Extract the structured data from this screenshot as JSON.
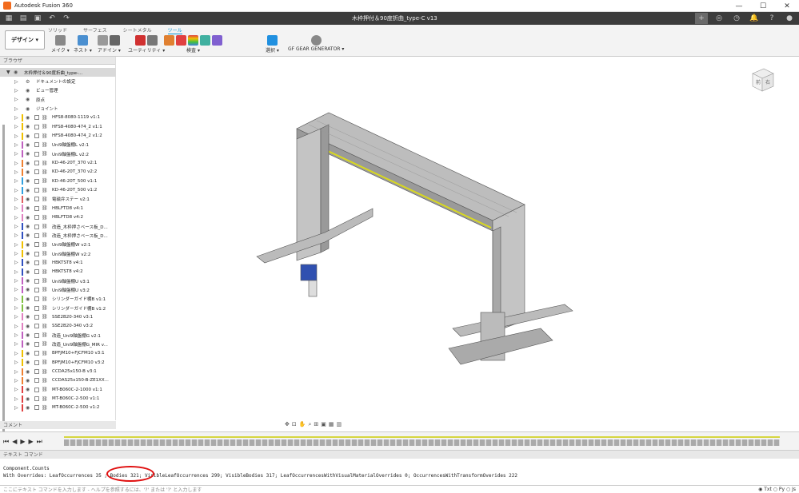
{
  "app": {
    "title": "Autodesk Fusion 360",
    "document_title": "木枠押付＆90度折曲_type-C v13"
  },
  "ribbon": {
    "tabs": [
      "ソリッド",
      "サーフェス",
      "シートメタル",
      "ツール"
    ],
    "active_tab": "ツール",
    "design_button": "デザイン ▾",
    "groups": [
      "メイク ▾",
      "ネスト ▾",
      "アドイン ▾",
      "ユーティリティ ▾",
      "検査 ▾",
      "選択 ▾",
      "GF GEAR GENERATOR ▾"
    ]
  },
  "browser": {
    "header": "ブラウザ",
    "root": "木枠押付＆90度折曲_type-...",
    "items": [
      "ドキュメントの設定",
      "ビュー管理",
      "原点",
      "ジョイント",
      "HFS8-8080-1119 v1:1",
      "HFS8-4080-474_2 v1:1",
      "HFS8-4080-474_2 v1:2",
      "Uni9軸盤棚L v2:1",
      "Uni9軸盤棚L v2:2",
      "KD-46-20T_370 v2:1",
      "KD-46-20T_370 v2:2",
      "KD-46-20T_500 v1:1",
      "KD-46-20T_500 v1:2",
      "電磁弁ステー v2:1",
      "HBLFTD8 v4:1",
      "HBLFTD8 v4:2",
      "改造_木枠押さベース板_D...",
      "改造_木枠押さベース板_D...",
      "Uni9軸盤棚W v2:1",
      "Uni9軸盤棚W v2:2",
      "HBKTST8 v4:1",
      "HBKTST8 v4:2",
      "Uni9軸盤棚U v3:1",
      "Uni9軸盤棚U v3:2",
      "シリンダーガイド棚B v1:1",
      "シリンダーガイド棚B v1:2",
      "SSE2B20-340 v3:1",
      "SSE2B20-340 v3:2",
      "改造_Uni9軸盤棚G v2:1",
      "改造_Uni9軸盤棚G_MIR v...",
      "BPFJM10+FJCFM10 v3:1",
      "BPFJM10+FJCFM10 v3:2",
      "CCDA25x150-B v3:1",
      "CCDAS25x150-B-ZE1XX...",
      "MT-B060C-2-1000 v1:1",
      "MT-B060C-2-500 v1:1",
      "MT-B060C-2-500 v1:2"
    ],
    "colors": [
      "#fff",
      "#fff",
      "#fff",
      "#fff",
      "#f0c000",
      "#f0c000",
      "#f0c000",
      "#c060c0",
      "#c060c0",
      "#f08030",
      "#f08030",
      "#30a0e0",
      "#30a0e0",
      "#e06060",
      "#e080c0",
      "#e080c0",
      "#3050c0",
      "#3050c0",
      "#f0c000",
      "#f0c000",
      "#3050c0",
      "#3050c0",
      "#c060c0",
      "#c060c0",
      "#80c040",
      "#80c040",
      "#e080c0",
      "#e080c0",
      "#c060c0",
      "#c060c0",
      "#f0c000",
      "#f0c000",
      "#f08030",
      "#f08030",
      "#e04040",
      "#e04040",
      "#e04040"
    ]
  },
  "comments": {
    "header": "コメント"
  },
  "textcommand": {
    "header": "テキスト コマンド",
    "line1": "Component.Counts",
    "line2": "With Overrides: LeafOccurrences 35 ; Bodies 321; VisibleLeafOccurrences 299; VisibleBodies 317; LeafOccurrencesWithVisualMaterialOverrides 0; OccurrencesWithTransformOverides 222",
    "input_placeholder": "ここにテキスト コマンドを入力します - ヘルプを参照するには、'?' または '?' と入力します",
    "modes": "◉ Txt ○ Py ○ Js"
  },
  "viewcube": {
    "top": "前",
    "right": "右"
  }
}
